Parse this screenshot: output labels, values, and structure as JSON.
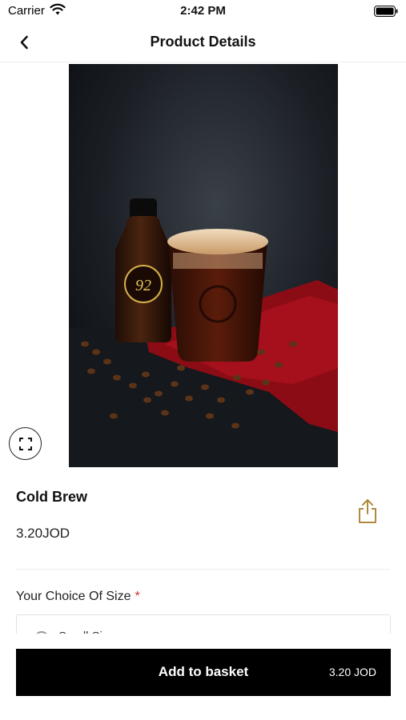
{
  "status_bar": {
    "carrier": "Carrier",
    "time": "2:42 PM"
  },
  "header": {
    "title": "Product Details"
  },
  "product": {
    "name": "Cold Brew",
    "price": "3.20JOD",
    "bottle_logo_text": "92"
  },
  "options": {
    "group_label": "Your Choice Of Size",
    "required_mark": "*",
    "first_option": "Small Size"
  },
  "footer": {
    "add_label": "Add to basket",
    "total": "3.20 JOD"
  },
  "colors": {
    "accent_gold": "#b08a3e",
    "required_red": "#d62b2b",
    "button_black": "#000000"
  },
  "icons": [
    "back-chevron-icon",
    "expand-icon",
    "share-icon",
    "wifi-icon",
    "battery-icon"
  ]
}
